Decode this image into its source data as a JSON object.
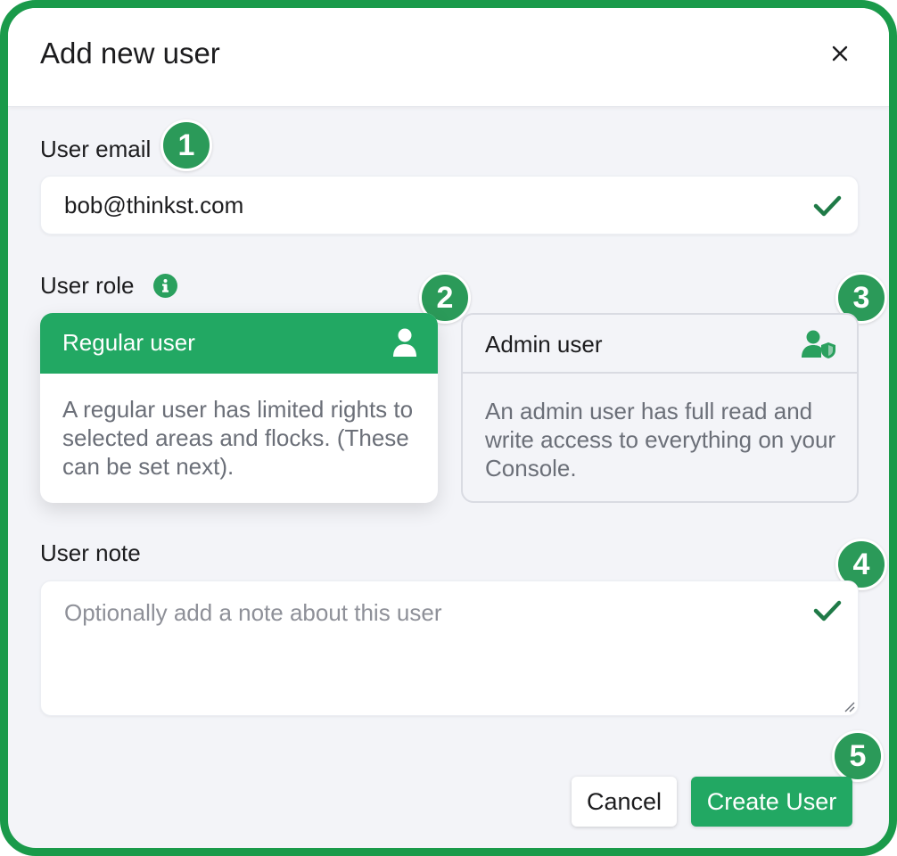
{
  "dialog": {
    "title": "Add new user",
    "close_icon": "close-icon"
  },
  "email": {
    "label": "User email",
    "value": "bob@thinkst.com",
    "valid_icon": "check-icon"
  },
  "role": {
    "label": "User role",
    "info_icon": "info-icon",
    "options": [
      {
        "title": "Regular user",
        "icon": "user-icon",
        "description": "A regular user has limited rights to selected areas and flocks. (These can be set next).",
        "selected": true
      },
      {
        "title": "Admin user",
        "icon": "admin-user-icon",
        "description": "An admin user has full read and write access to everything on your Console.",
        "selected": false
      }
    ]
  },
  "note": {
    "label": "User note",
    "placeholder": "Optionally add a note about this user",
    "valid_icon": "check-icon"
  },
  "actions": {
    "cancel_label": "Cancel",
    "create_label": "Create User"
  },
  "markers": [
    "1",
    "2",
    "3",
    "4",
    "5"
  ],
  "colors": {
    "frame": "#1a9a4a",
    "accent": "#22a863",
    "marker": "#2b9a59",
    "background": "#f3f4f8"
  }
}
